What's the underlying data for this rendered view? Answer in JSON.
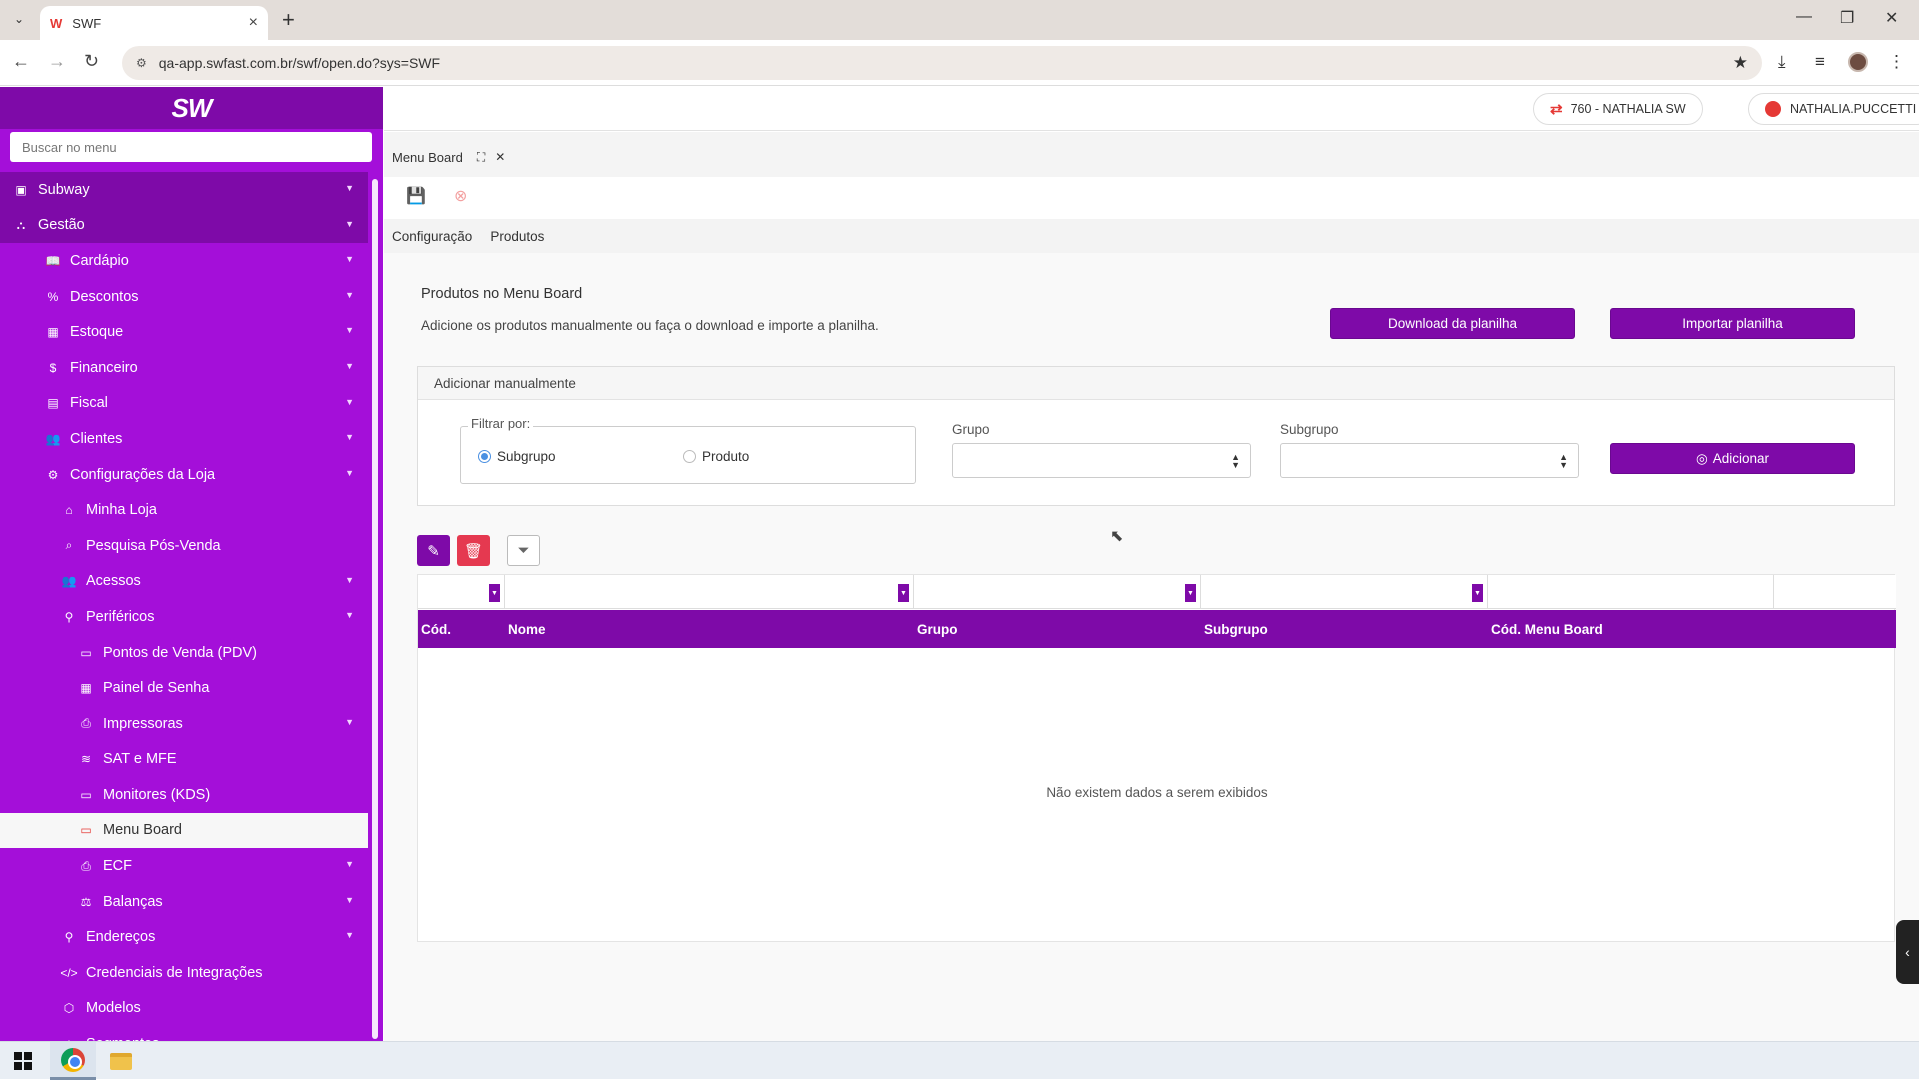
{
  "browser": {
    "tab_title": "SWF",
    "tab_favicon": "W",
    "url": "qa-app.swfast.com.br/swf/open.do?sys=SWF"
  },
  "sidebar": {
    "logo": "SW",
    "search_placeholder": "Buscar no menu",
    "items": [
      {
        "label": "Subway",
        "icon": "store-icon",
        "glyph": "▣",
        "level": 0,
        "top": true,
        "expand": true
      },
      {
        "label": "Gestão",
        "icon": "sitemap-icon",
        "glyph": "⛬",
        "level": 0,
        "top": true,
        "expand": true
      },
      {
        "label": "Cardápio",
        "icon": "book-icon",
        "glyph": "📖",
        "level": 1,
        "expand": true
      },
      {
        "label": "Descontos",
        "icon": "percent-icon",
        "glyph": "%",
        "level": 1,
        "expand": true
      },
      {
        "label": "Estoque",
        "icon": "boxes-icon",
        "glyph": "▦",
        "level": 1,
        "expand": true
      },
      {
        "label": "Financeiro",
        "icon": "dollar-icon",
        "glyph": "$",
        "level": 1,
        "expand": true
      },
      {
        "label": "Fiscal",
        "icon": "file-icon",
        "glyph": "▤",
        "level": 1,
        "expand": true
      },
      {
        "label": "Clientes",
        "icon": "users-icon",
        "glyph": "👥",
        "level": 1,
        "expand": true
      },
      {
        "label": "Configurações da Loja",
        "icon": "cogs-icon",
        "glyph": "⚙",
        "level": 1,
        "expand": true
      },
      {
        "label": "Minha Loja",
        "icon": "shop-icon",
        "glyph": "⌂",
        "level": 2,
        "expand": false
      },
      {
        "label": "Pesquisa Pós-Venda",
        "icon": "search-icon",
        "glyph": "⌕",
        "level": 2,
        "expand": false
      },
      {
        "label": "Acessos",
        "icon": "users-icon",
        "glyph": "👥",
        "level": 2,
        "expand": true
      },
      {
        "label": "Periféricos",
        "icon": "plug-icon",
        "glyph": "⚲",
        "level": 2,
        "expand": true
      },
      {
        "label": "Pontos de Venda (PDV)",
        "icon": "laptop-icon",
        "glyph": "▭",
        "level": 3,
        "expand": false
      },
      {
        "label": "Painel de Senha",
        "icon": "panel-icon",
        "glyph": "▦",
        "level": 3,
        "expand": false
      },
      {
        "label": "Impressoras",
        "icon": "printer-icon",
        "glyph": "⎙",
        "level": 3,
        "expand": true
      },
      {
        "label": "SAT e MFE",
        "icon": "wifi-icon",
        "glyph": "≋",
        "level": 3,
        "expand": false
      },
      {
        "label": "Monitores (KDS)",
        "icon": "monitor-icon",
        "glyph": "▭",
        "level": 3,
        "expand": false
      },
      {
        "label": "Menu Board",
        "icon": "monitor-icon",
        "glyph": "▭",
        "level": 3,
        "expand": false,
        "active": true
      },
      {
        "label": "ECF",
        "icon": "printer-icon",
        "glyph": "⎙",
        "level": 3,
        "expand": true
      },
      {
        "label": "Balanças",
        "icon": "scale-icon",
        "glyph": "⚖",
        "level": 3,
        "expand": true
      },
      {
        "label": "Endereços",
        "icon": "map-marker-icon",
        "glyph": "⚲",
        "level": 2,
        "expand": true
      },
      {
        "label": "Credenciais de Integrações",
        "icon": "code-icon",
        "glyph": "</>",
        "level": 2,
        "expand": false
      },
      {
        "label": "Modelos",
        "icon": "cube-icon",
        "glyph": "⬡",
        "level": 2,
        "expand": false
      },
      {
        "label": "Segmentos",
        "icon": "tag-icon",
        "glyph": "◈",
        "level": 2,
        "expand": false
      }
    ]
  },
  "header": {
    "store_label": "760 - NATHALIA SW",
    "user_label": "NATHALIA.PUCCETTI"
  },
  "page_tab": {
    "label": "Menu Board"
  },
  "subtabs": [
    "Configuração",
    "Produtos"
  ],
  "main": {
    "title": "Produtos no Menu Board",
    "description": "Adicione os produtos manualmente ou faça o download e importe a planilha.",
    "download_label": "Download da planilha",
    "import_label": "Importar planilha",
    "panel_title": "Adicionar manualmente",
    "filter_legend": "Filtrar por:",
    "radio_subgrupo": "Subgrupo",
    "radio_produto": "Produto",
    "grupo_label": "Grupo",
    "subgrupo_label": "Subgrupo",
    "add_label": "Adicionar"
  },
  "grid": {
    "columns": [
      "Cód.",
      "Nome",
      "Grupo",
      "Subgrupo",
      "Cód. Menu Board"
    ],
    "empty_message": "Não existem dados a serem exibidos"
  },
  "colors": {
    "sidebar": "#a40fd9",
    "brand_dark": "#7e0aa8",
    "accent_red": "#e53935"
  }
}
